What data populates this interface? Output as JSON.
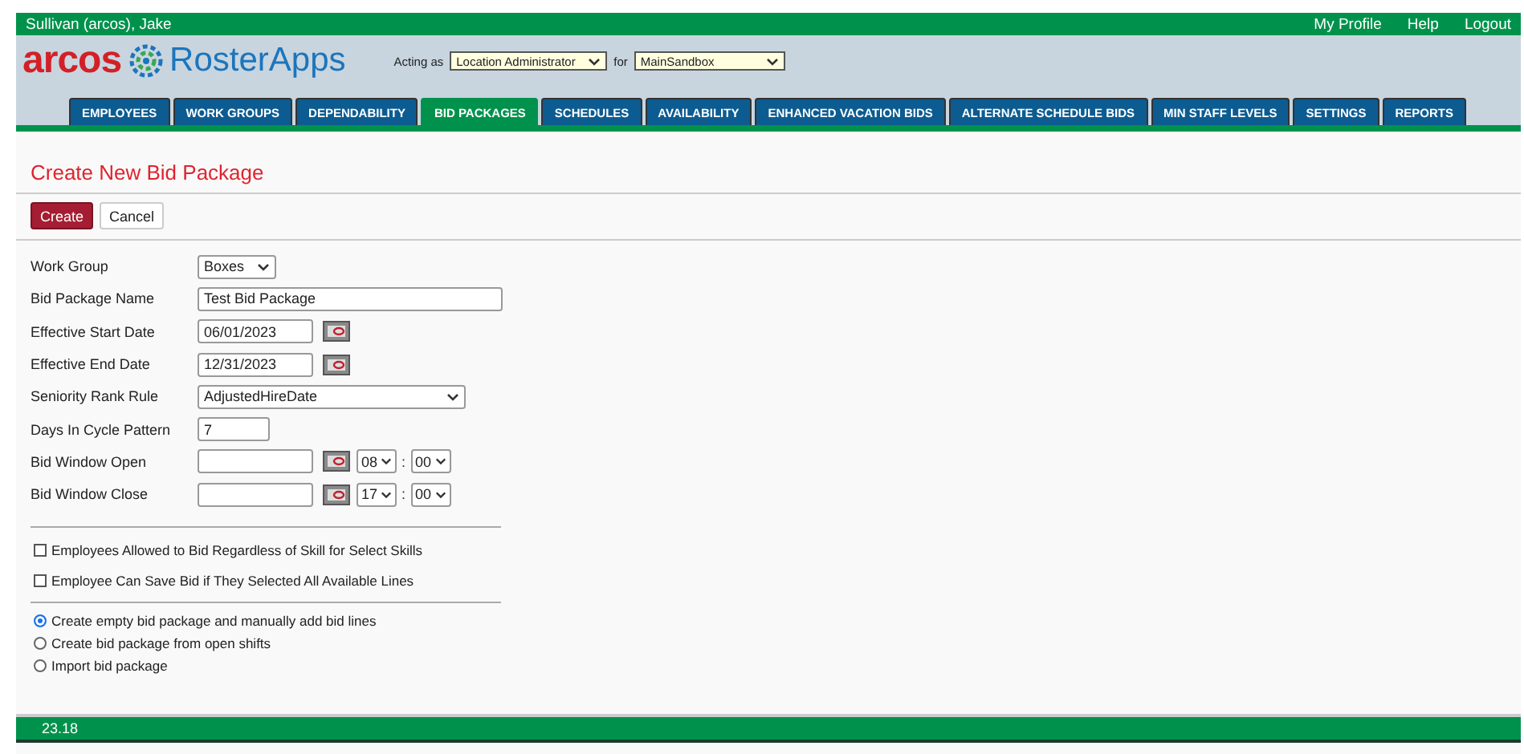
{
  "top_bar": {
    "user": "Sullivan (arcos), Jake",
    "links": [
      "My Profile",
      "Help",
      "Logout"
    ]
  },
  "header": {
    "logo_brand": "arcos",
    "logo_product": "RosterApps",
    "acting_as_label": "Acting as",
    "acting_as": "Location Administrator",
    "for_label": "for",
    "for": "MainSandbox"
  },
  "tabs": [
    {
      "label": "EMPLOYEES",
      "selected": false
    },
    {
      "label": "WORK GROUPS",
      "selected": false
    },
    {
      "label": "DEPENDABILITY",
      "selected": false
    },
    {
      "label": "BID PACKAGES",
      "selected": true
    },
    {
      "label": "SCHEDULES",
      "selected": false
    },
    {
      "label": "AVAILABILITY",
      "selected": false
    },
    {
      "label": "ENHANCED VACATION BIDS",
      "selected": false
    },
    {
      "label": "ALTERNATE SCHEDULE BIDS",
      "selected": false
    },
    {
      "label": "MIN STAFF LEVELS",
      "selected": false
    },
    {
      "label": "SETTINGS",
      "selected": false
    },
    {
      "label": "REPORTS",
      "selected": false
    }
  ],
  "page_title": "Create New Bid Package",
  "buttons": [
    {
      "label": "Create",
      "kind": "primary"
    },
    {
      "label": "Cancel",
      "kind": "secondary"
    }
  ],
  "fields": [
    {
      "label": "Work Group",
      "kind": "select",
      "value": "Boxes"
    },
    {
      "label": "Bid Package Name",
      "kind": "text",
      "value": "Test Bid Package"
    },
    {
      "label": "Effective Start Date",
      "kind": "date",
      "value": "06/01/2023"
    },
    {
      "label": "Effective End Date",
      "kind": "date",
      "value": "12/31/2023"
    },
    {
      "label": "Seniority Rank Rule",
      "kind": "wideselect",
      "value": "AdjustedHireDate"
    },
    {
      "label": "Days In Cycle Pattern",
      "kind": "short",
      "value": "7"
    },
    {
      "label": "Bid Window Open",
      "kind": "datetime",
      "hour": "08",
      "separator": ":",
      "minute": "00"
    },
    {
      "label": "Bid Window Close",
      "kind": "datetime",
      "hour": "17",
      "separator": ":",
      "minute": "00"
    }
  ],
  "checkboxes": [
    {
      "label": "Employees Allowed to Bid Regardless of Skill for Select Skills",
      "checked": false
    },
    {
      "label": "Employee Can Save Bid if They Selected All Available Lines",
      "checked": false
    }
  ],
  "radios": [
    {
      "label": "Create empty bid package and manually add bid lines",
      "selected": true
    },
    {
      "label": "Create bid package from open shifts",
      "selected": false
    },
    {
      "label": "Import bid package",
      "selected": false
    }
  ],
  "footer": {
    "version": "23.18"
  }
}
